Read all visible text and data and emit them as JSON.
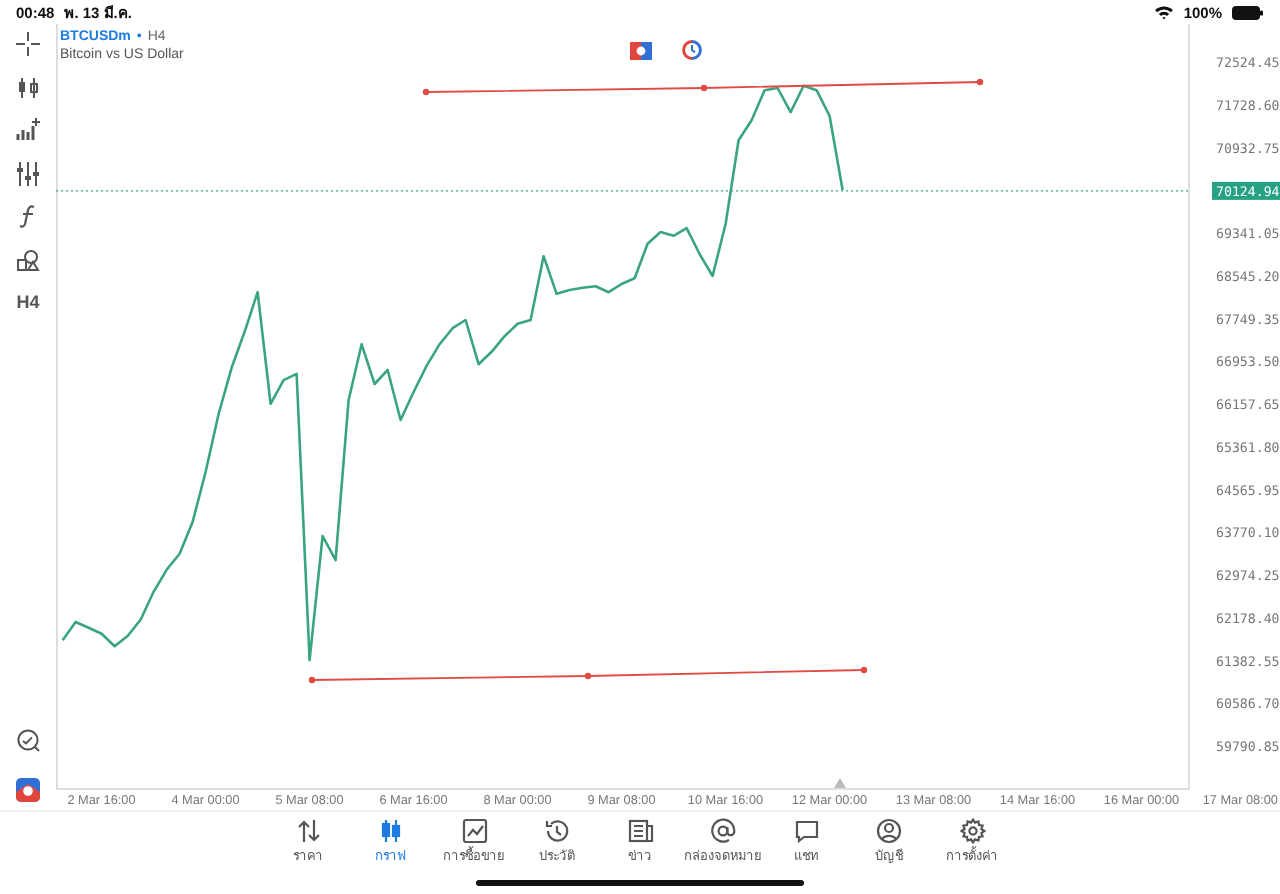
{
  "status_bar": {
    "time": "00:48",
    "date": "พ. 13 มี.ค.",
    "battery": "100%"
  },
  "toolbar": {
    "timeframe": "H4"
  },
  "chart": {
    "symbol": "BTCUSDm",
    "separator": "•",
    "timeframe": "H4",
    "description": "Bitcoin vs US Dollar",
    "current_price": "70124.94",
    "chart_data": {
      "type": "line",
      "categories": [
        null,
        null,
        null,
        "2 Mar 16:00",
        null,
        null,
        null,
        null,
        null,
        null,
        null,
        "4 Mar 00:00",
        null,
        null,
        null,
        null,
        null,
        null,
        null,
        "5 Mar 08:00",
        null,
        null,
        null,
        null,
        null,
        null,
        null,
        "6 Mar 16:00",
        null,
        null,
        null,
        null,
        null,
        null,
        null,
        "8 Mar 00:00",
        null,
        null,
        null,
        null,
        null,
        null,
        null,
        "9 Mar 08:00",
        null,
        null,
        null,
        null,
        null,
        null,
        null,
        "10 Mar 16:00",
        null,
        null,
        null,
        null,
        null,
        null,
        null,
        "12 Mar 00:00",
        null,
        null,
        null,
        null,
        null,
        null,
        null,
        "13 Mar 08:00",
        null,
        null,
        null,
        null,
        null,
        null,
        null,
        "14 Mar 16:00",
        null,
        null,
        null,
        null,
        null,
        null,
        null,
        "16 Mar 00:00",
        null,
        null,
        null,
        null,
        null,
        null,
        null,
        "17 Mar 08:00"
      ],
      "series": [
        {
          "color": "#3aa57c",
          "values": [
            61760,
            62100,
            61990,
            61880,
            61650,
            61840,
            62140,
            62660,
            63070,
            63370,
            63960,
            64890,
            65970,
            66830,
            67500,
            68240,
            66160,
            66600,
            66720,
            61390,
            63700,
            63250,
            66230,
            67270,
            66530,
            66790,
            65860,
            66380,
            66870,
            67270,
            67570,
            67720,
            66900,
            67130,
            67420,
            67650,
            67720,
            68910,
            68210,
            68280,
            68320,
            68350,
            68240,
            68390,
            68500,
            69140,
            69360,
            69290,
            69430,
            68950,
            68540,
            69510,
            71070,
            71440,
            72000,
            72040,
            71590,
            72080,
            72000,
            71520,
            70140,
            null,
            null,
            null,
            null,
            null,
            null,
            null,
            null,
            null,
            null,
            null,
            null,
            null,
            null,
            null,
            null,
            null,
            null,
            null,
            null,
            null,
            null,
            null,
            null,
            null,
            null,
            null,
            null,
            null,
            null,
            null
          ]
        }
      ],
      "ylim": [
        59009,
        73232
      ],
      "yticks": [
        {
          "value": 72524.45,
          "label": "72524.45"
        },
        {
          "value": 71728.6,
          "label": "71728.60"
        },
        {
          "value": 70932.75,
          "label": "70932.75"
        },
        {
          "value": 69341.05,
          "label": "69341.05"
        },
        {
          "value": 68545.2,
          "label": "68545.20"
        },
        {
          "value": 67749.35,
          "label": "67749.35"
        },
        {
          "value": 66953.5,
          "label": "66953.50"
        },
        {
          "value": 66157.65,
          "label": "66157.65"
        },
        {
          "value": 65361.8,
          "label": "65361.80"
        },
        {
          "value": 64565.95,
          "label": "64565.95"
        },
        {
          "value": 63770.1,
          "label": "63770.10"
        },
        {
          "value": 62974.25,
          "label": "62974.25"
        },
        {
          "value": 62178.4,
          "label": "62178.40"
        },
        {
          "value": 61382.55,
          "label": "61382.55"
        },
        {
          "value": 60586.7,
          "label": "60586.70"
        },
        {
          "value": 59790.85,
          "label": "59790.85"
        }
      ]
    }
  },
  "tabs": [
    {
      "label": "ราคา",
      "selected": false
    },
    {
      "label": "กราฟ",
      "selected": true
    },
    {
      "label": "การซื้อขาย",
      "selected": false
    },
    {
      "label": "ประวัติ",
      "selected": false
    },
    {
      "label": "ข่าว",
      "selected": false
    },
    {
      "label": "กล่องจดหมาย",
      "selected": false
    },
    {
      "label": "แชท",
      "selected": false
    },
    {
      "label": "บัญชี",
      "selected": false
    },
    {
      "label": "การตั้งค่า",
      "selected": false
    }
  ]
}
